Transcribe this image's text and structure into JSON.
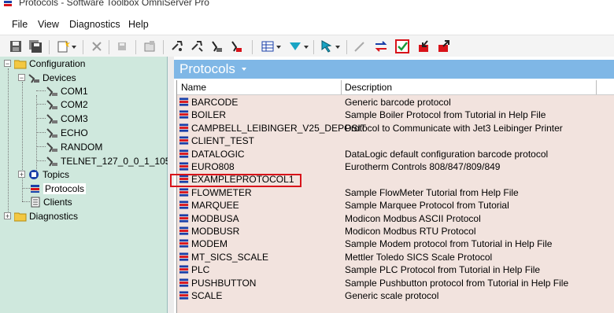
{
  "window": {
    "title": "Protocols - Software Toolbox OmniServer Pro",
    "app_icon": "omniserver-app-icon"
  },
  "menu": {
    "file": "File",
    "view": "View",
    "diagnostics": "Diagnostics",
    "help": "Help"
  },
  "toolbar": {
    "buttons": [
      "save-icon",
      "save-all-icon",
      "new-dropdown-icon",
      "delete-icon",
      "disk-icon",
      "properties-icon",
      "wrench-icon",
      "wrench-alt-icon",
      "connect-icon",
      "disconnect-icon",
      "grid-view-icon",
      "send-icon",
      "pointer-icon",
      "pen-icon",
      "swap-arrows-icon",
      "checkmark-icon",
      "import-icon",
      "export-icon"
    ]
  },
  "tree": {
    "configuration": "Configuration",
    "devices": "Devices",
    "device_items": [
      "COM1",
      "COM2",
      "COM3",
      "ECHO",
      "RANDOM",
      "TELNET_127_0_0_1_105"
    ],
    "topics": "Topics",
    "protocols": "Protocols",
    "clients": "Clients",
    "diagnostics": "Diagnostics"
  },
  "panel": {
    "title": "Protocols"
  },
  "columns": {
    "name": "Name",
    "description": "Description"
  },
  "protocols": [
    {
      "name": "BARCODE",
      "description": "Generic barcode protocol"
    },
    {
      "name": "BOILER",
      "description": "Sample Boiler Protocol from Tutorial in Help File"
    },
    {
      "name": "CAMPBELL_LEIBINGER_V25_DEPOSIT",
      "description": "Protocol to Communicate with Jet3 Leibinger Printer"
    },
    {
      "name": "CLIENT_TEST",
      "description": ""
    },
    {
      "name": "DATALOGIC",
      "description": "DataLogic default configuration barcode protocol"
    },
    {
      "name": "EURO808",
      "description": "Eurotherm Controls 808/847/809/849"
    },
    {
      "name": "EXAMPLEPROTOCOL1",
      "description": ""
    },
    {
      "name": "FLOWMETER",
      "description": "Sample FlowMeter Tutorial from Help File"
    },
    {
      "name": "MARQUEE",
      "description": "Sample Marquee Protocol from Tutorial"
    },
    {
      "name": "MODBUSA",
      "description": "Modicon Modbus ASCII Protocol"
    },
    {
      "name": "MODBUSR",
      "description": "Modicon Modbus RTU Protocol"
    },
    {
      "name": "MODEM",
      "description": "Sample Modem protocol from Tutorial in Help File"
    },
    {
      "name": "MT_SICS_SCALE",
      "description": "Mettler Toledo SICS Scale Protocol"
    },
    {
      "name": "PLC",
      "description": "Sample PLC Protocol from Tutorial in Help File"
    },
    {
      "name": "PUSHBUTTON",
      "description": "Sample Pushbutton protocol from Tutorial in Help File"
    },
    {
      "name": "SCALE",
      "description": "Generic scale protocol"
    }
  ],
  "colors": {
    "tree_bg": "#cfe8dd",
    "panel_header": "#7fb7e6",
    "list_bg": "#f2e3de",
    "highlight": "#d8131a"
  }
}
